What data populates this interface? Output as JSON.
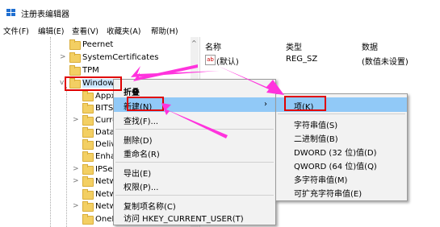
{
  "window": {
    "title": "注册表编辑器"
  },
  "menubar": {
    "items": [
      "文件(F)",
      "编辑(E)",
      "查看(V)",
      "收藏夹(A)",
      "帮助(H)"
    ]
  },
  "tree": {
    "items": [
      {
        "label": "Peernet",
        "expandable": false
      },
      {
        "label": "SystemCertificates",
        "expandable": true
      },
      {
        "label": "TPM",
        "expandable": false
      },
      {
        "label": "Window",
        "expandable": true,
        "expanded": true
      },
      {
        "label": "Appx",
        "expandable": false
      },
      {
        "label": "BITS",
        "expandable": false
      },
      {
        "label": "Curre",
        "expandable": true
      },
      {
        "label": "Datal",
        "expandable": false
      },
      {
        "label": "Deliv",
        "expandable": false
      },
      {
        "label": "Enha",
        "expandable": false
      },
      {
        "label": "IPSec",
        "expandable": true
      },
      {
        "label": "Netw",
        "expandable": true
      },
      {
        "label": "Netw",
        "expandable": false
      },
      {
        "label": "Netw",
        "expandable": true
      },
      {
        "label": "OneD",
        "expandable": false
      }
    ]
  },
  "list": {
    "headers": {
      "name": "名称",
      "type": "类型",
      "data": "数据"
    },
    "rows": [
      {
        "name": "(默认)",
        "type": "REG_SZ",
        "data": "(数值未设置)"
      }
    ]
  },
  "context_menu": {
    "items": [
      "折叠",
      "新建(N)",
      "查找(F)...",
      "删除(D)",
      "重命名(R)",
      "导出(E)",
      "权限(P)...",
      "复制项名称(C)",
      "访问 HKEY_CURRENT_USER(T)"
    ],
    "submenu_arrow": "›"
  },
  "submenu": {
    "items": [
      "项(K)",
      "字符串值(S)",
      "二进制值(B)",
      "DWORD (32 位)值(D)",
      "QWORD (64 位)值(Q)",
      "多字符串值(M)",
      "可扩充字符串值(E)"
    ]
  },
  "colors": {
    "annotation_box": "#e00000",
    "arrow": "#ff33dd",
    "selection": "#91c9f7"
  },
  "icons": {
    "app": "registry-editor-icon",
    "value": "string-value-icon"
  }
}
